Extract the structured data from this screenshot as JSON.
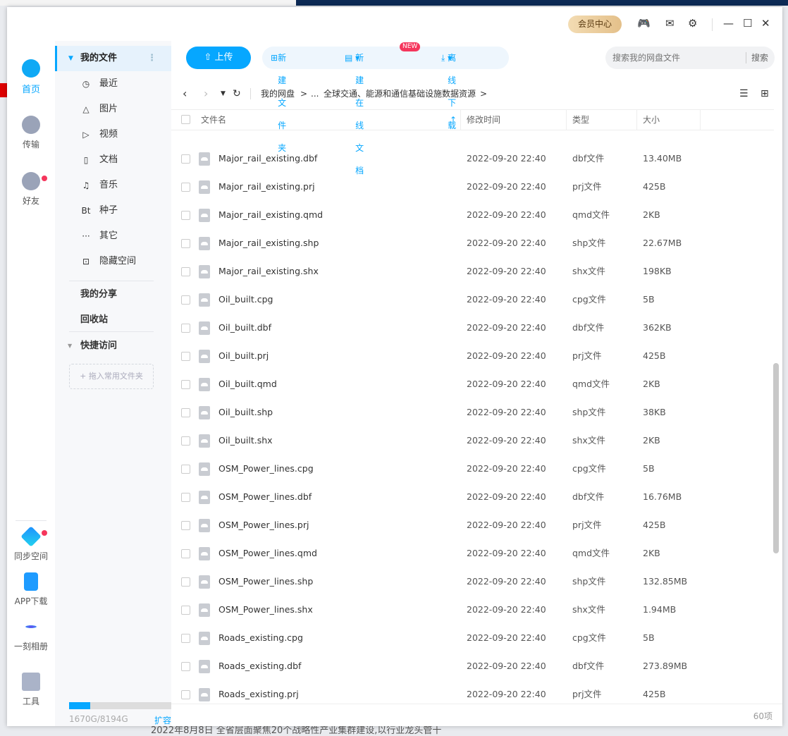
{
  "background": {
    "bottom_text": "2022年8月8日 全省层面聚焦20个战略性产业集群建设,以行业龙头管十"
  },
  "titlebar": {
    "vip": "会员中心"
  },
  "rail": {
    "home": "首页",
    "transfer": "传输",
    "friends": "好友",
    "sync": "同步空间",
    "app": "APP下载",
    "album": "一刻相册",
    "tools": "工具"
  },
  "sidebar": {
    "my_files": "我的文件",
    "items": [
      {
        "icon": "clock-icon",
        "glyph": "◷",
        "label": "最近"
      },
      {
        "icon": "image-icon",
        "glyph": "△",
        "label": "图片"
      },
      {
        "icon": "video-icon",
        "glyph": "▷",
        "label": "视频"
      },
      {
        "icon": "doc-icon",
        "glyph": "▯",
        "label": "文档"
      },
      {
        "icon": "music-icon",
        "glyph": "♫",
        "label": "音乐"
      },
      {
        "icon": "bt-icon",
        "glyph": "Bt",
        "label": "种子"
      },
      {
        "icon": "more-icon",
        "glyph": "···",
        "label": "其它"
      },
      {
        "icon": "lock-icon",
        "glyph": "⊡",
        "label": "隐藏空间"
      }
    ],
    "share": "我的分享",
    "recycle": "回收站",
    "quick": "快捷访问",
    "drag_hint": "+ 拖入常用文件夹",
    "storage": "1670G/8194G",
    "storage_used_fraction": 0.204,
    "expand": "扩容"
  },
  "toolbar": {
    "upload": "上传",
    "new_folder": "新建文件夹",
    "new_doc": "新建在线文档",
    "new_badge": "NEW",
    "offline": "离线下载",
    "search_placeholder": "搜索我的网盘文件",
    "search_btn": "搜索"
  },
  "breadcrumb": {
    "root": "我的网盘",
    "ellipsis": "...",
    "current": "全球交通、能源和通信基础设施数据资源"
  },
  "table": {
    "headers": {
      "name": "文件名",
      "time": "修改时间",
      "type": "类型",
      "size": "大小"
    },
    "rows": [
      {
        "name": "Major_rail_existing.dbf",
        "time": "2022-09-20 22:40",
        "type": "dbf文件",
        "size": "13.40MB"
      },
      {
        "name": "Major_rail_existing.prj",
        "time": "2022-09-20 22:40",
        "type": "prj文件",
        "size": "425B"
      },
      {
        "name": "Major_rail_existing.qmd",
        "time": "2022-09-20 22:40",
        "type": "qmd文件",
        "size": "2KB"
      },
      {
        "name": "Major_rail_existing.shp",
        "time": "2022-09-20 22:40",
        "type": "shp文件",
        "size": "22.67MB"
      },
      {
        "name": "Major_rail_existing.shx",
        "time": "2022-09-20 22:40",
        "type": "shx文件",
        "size": "198KB"
      },
      {
        "name": "Oil_built.cpg",
        "time": "2022-09-20 22:40",
        "type": "cpg文件",
        "size": "5B"
      },
      {
        "name": "Oil_built.dbf",
        "time": "2022-09-20 22:40",
        "type": "dbf文件",
        "size": "362KB"
      },
      {
        "name": "Oil_built.prj",
        "time": "2022-09-20 22:40",
        "type": "prj文件",
        "size": "425B"
      },
      {
        "name": "Oil_built.qmd",
        "time": "2022-09-20 22:40",
        "type": "qmd文件",
        "size": "2KB"
      },
      {
        "name": "Oil_built.shp",
        "time": "2022-09-20 22:40",
        "type": "shp文件",
        "size": "38KB"
      },
      {
        "name": "Oil_built.shx",
        "time": "2022-09-20 22:40",
        "type": "shx文件",
        "size": "2KB"
      },
      {
        "name": "OSM_Power_lines.cpg",
        "time": "2022-09-20 22:40",
        "type": "cpg文件",
        "size": "5B"
      },
      {
        "name": "OSM_Power_lines.dbf",
        "time": "2022-09-20 22:40",
        "type": "dbf文件",
        "size": "16.76MB"
      },
      {
        "name": "OSM_Power_lines.prj",
        "time": "2022-09-20 22:40",
        "type": "prj文件",
        "size": "425B"
      },
      {
        "name": "OSM_Power_lines.qmd",
        "time": "2022-09-20 22:40",
        "type": "qmd文件",
        "size": "2KB"
      },
      {
        "name": "OSM_Power_lines.shp",
        "time": "2022-09-20 22:40",
        "type": "shp文件",
        "size": "132.85MB"
      },
      {
        "name": "OSM_Power_lines.shx",
        "time": "2022-09-20 22:40",
        "type": "shx文件",
        "size": "1.94MB"
      },
      {
        "name": "Roads_existing.cpg",
        "time": "2022-09-20 22:40",
        "type": "cpg文件",
        "size": "5B"
      },
      {
        "name": "Roads_existing.dbf",
        "time": "2022-09-20 22:40",
        "type": "dbf文件",
        "size": "273.89MB"
      },
      {
        "name": "Roads_existing.prj",
        "time": "2022-09-20 22:40",
        "type": "prj文件",
        "size": "425B"
      }
    ]
  },
  "footer": {
    "count": "60项"
  }
}
